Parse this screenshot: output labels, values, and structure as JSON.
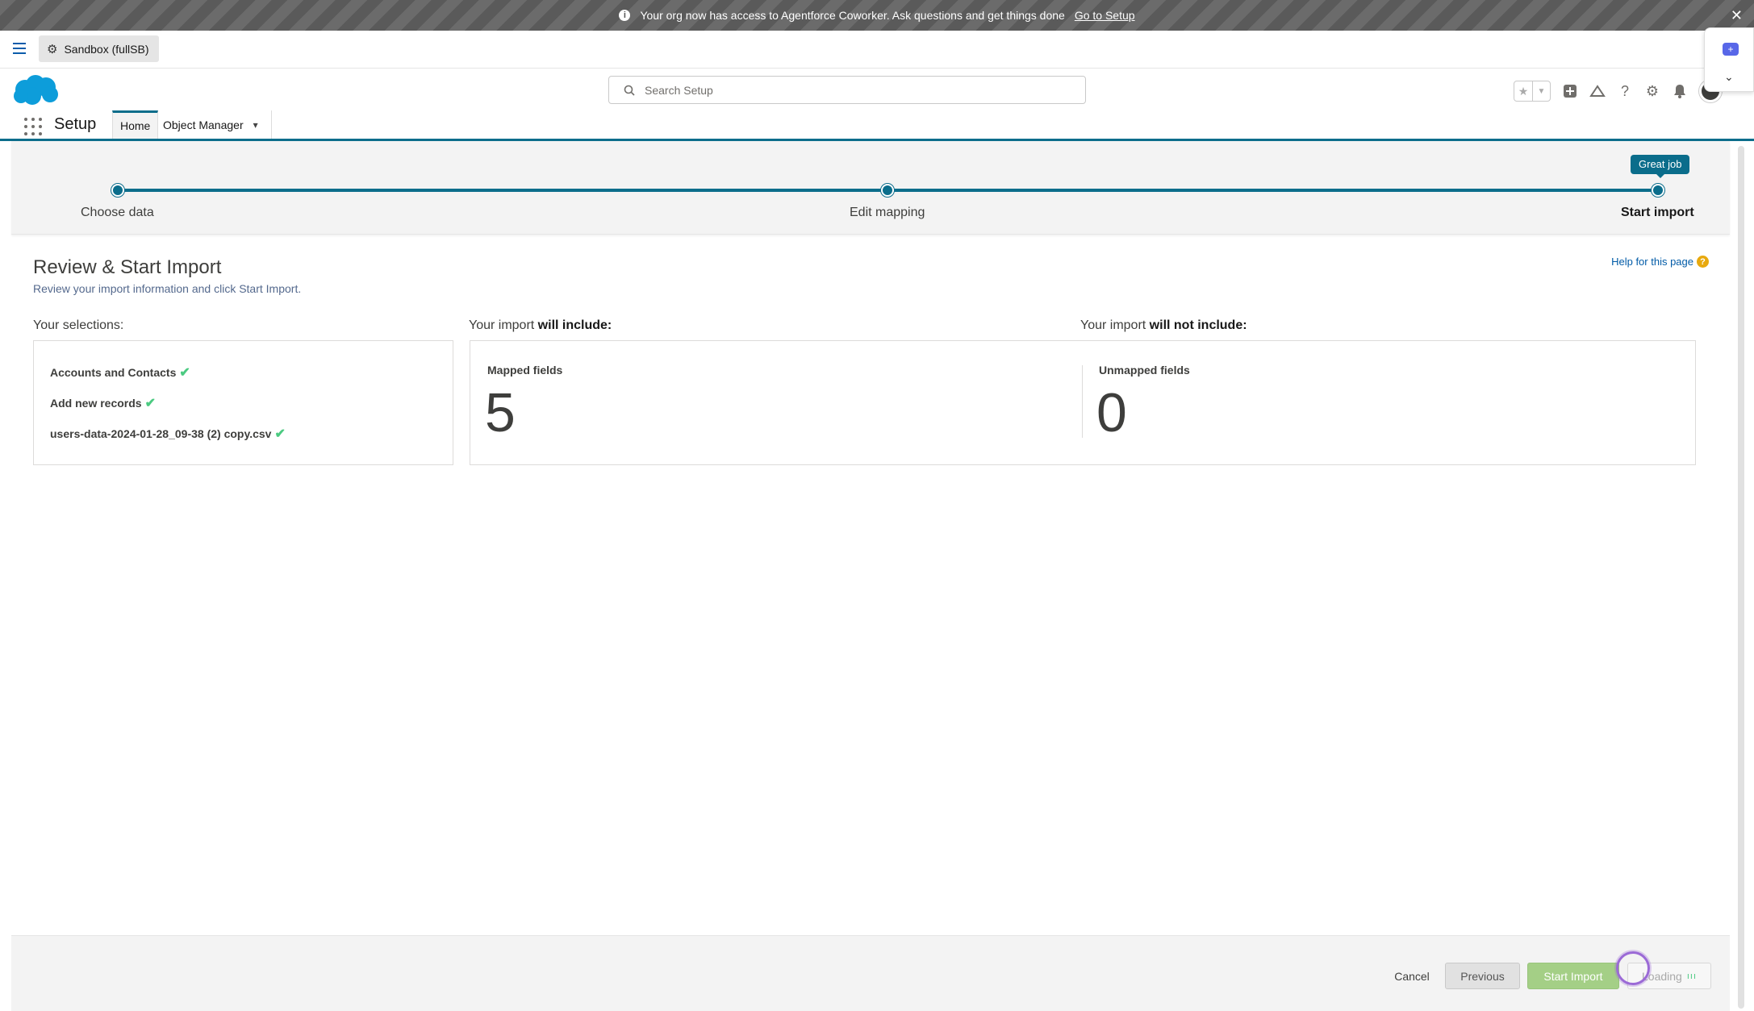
{
  "banner": {
    "message": "Your org now has access to Agentforce Coworker. Ask questions and get things done",
    "link_label": "Go to Setup",
    "close_glyph": "✕"
  },
  "sandbox": {
    "label": "Sandbox (fullSB)"
  },
  "search": {
    "placeholder": "Search Setup"
  },
  "nav": {
    "app_name": "Setup",
    "tabs": [
      {
        "label": "Home"
      },
      {
        "label": "Object Manager"
      }
    ]
  },
  "progress": {
    "tooltip": "Great job",
    "steps": [
      {
        "label": "Choose data"
      },
      {
        "label": "Edit mapping"
      },
      {
        "label": "Start import"
      }
    ]
  },
  "review": {
    "title": "Review & Start Import",
    "subtitle": "Review your import information and click Start Import.",
    "help_link": "Help for this page",
    "selections_label": "Your selections:",
    "include_prefix": "Your import ",
    "include_bold": "will include:",
    "exclude_prefix": "Your import ",
    "exclude_bold": "will not include:",
    "selections": [
      {
        "label": "Accounts and Contacts"
      },
      {
        "label": "Add new records"
      },
      {
        "label": "users-data-2024-01-28_09-38 (2) copy.csv"
      }
    ],
    "mapped_label": "Mapped fields",
    "mapped_count": "5",
    "unmapped_label": "Unmapped fields",
    "unmapped_count": "0"
  },
  "footer": {
    "cancel": "Cancel",
    "previous": "Previous",
    "start_import": "Start Import",
    "loading": "Loading"
  },
  "colors": {
    "accent": "#0b6d8b",
    "start_button": "#a4cf86",
    "check": "#4bca81"
  }
}
